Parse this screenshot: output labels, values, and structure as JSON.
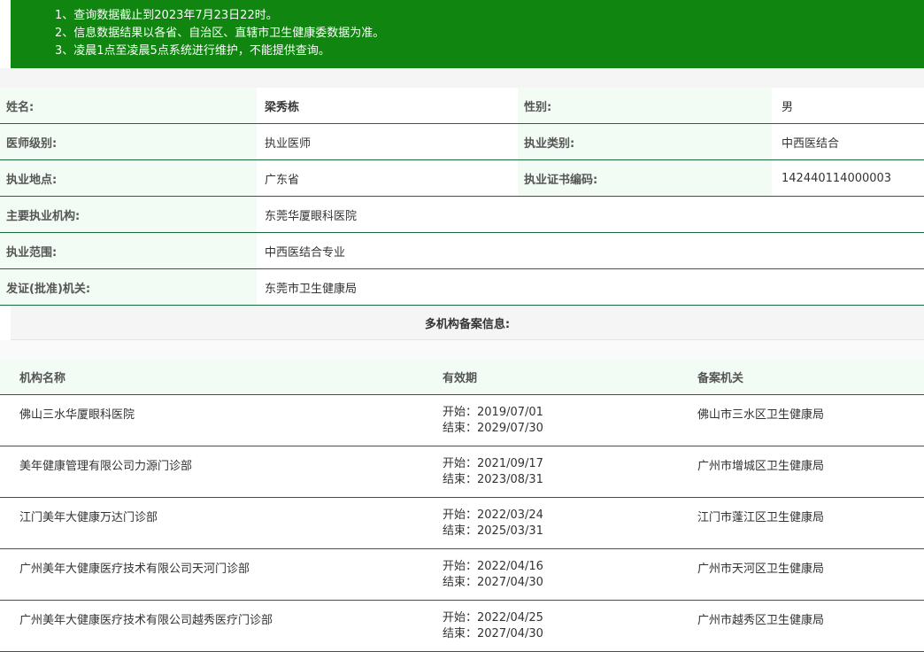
{
  "notice": {
    "lines": [
      "1、查询数据截止到2023年7月23日22时。",
      "2、信息数据结果以各省、自治区、直辖市卫生健康委数据为准。",
      "3、凌晨1点至凌晨5点系统进行维护，不能提供查询。"
    ]
  },
  "doctor": {
    "name_label": "姓名:",
    "name": "梁秀栋",
    "gender_label": "性别:",
    "gender": "男",
    "level_label": "医师级别:",
    "level": "执业医师",
    "category_label": "执业类别:",
    "category": "中西医结合",
    "location_label": "执业地点:",
    "location": "广东省",
    "cert_label": "执业证书编码:",
    "cert": "142440114000003",
    "org_label": "主要执业机构:",
    "org": "东莞华厦眼科医院",
    "scope_label": "执业范围:",
    "scope": "中西医结合专业",
    "issuer_label": "发证(批准)机关:",
    "issuer": "东莞市卫生健康局"
  },
  "multi": {
    "title": "多机构备案信息:",
    "headers": [
      "机构名称",
      "有效期",
      "备案机关"
    ],
    "rows": [
      {
        "name": "佛山三水华厦眼科医院",
        "start": "开始：2019/07/01",
        "end": "结束：2029/07/30",
        "authority": "佛山市三水区卫生健康局"
      },
      {
        "name": "美年健康管理有限公司力源门诊部",
        "start": "开始：2021/09/17",
        "end": "结束：2023/08/31",
        "authority": "广州市增城区卫生健康局"
      },
      {
        "name": "江门美年大健康万达门诊部",
        "start": "开始：2022/03/24",
        "end": "结束：2025/03/31",
        "authority": "江门市蓬江区卫生健康局"
      },
      {
        "name": "广州美年大健康医疗技术有限公司天河门诊部",
        "start": "开始：2022/04/16",
        "end": "结束：2027/04/30",
        "authority": "广州市天河区卫生健康局"
      },
      {
        "name": "广州美年大健康医疗技术有限公司越秀医疗门诊部",
        "start": "开始：2022/04/25",
        "end": "结束：2027/04/30",
        "authority": "广州市越秀区卫生健康局"
      }
    ]
  }
}
